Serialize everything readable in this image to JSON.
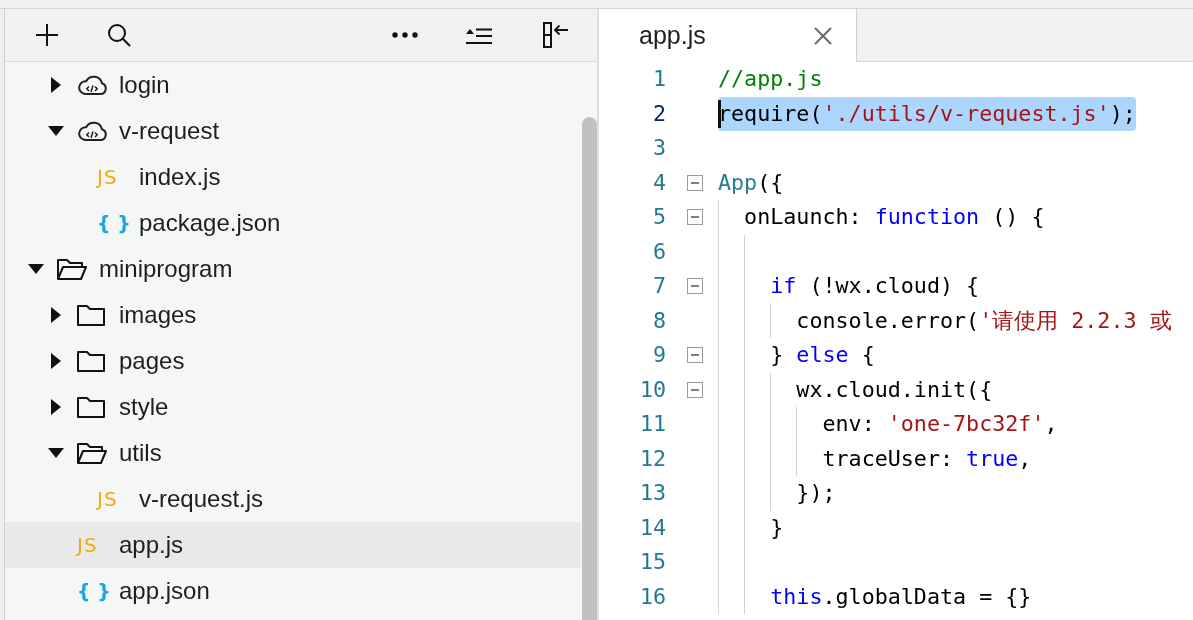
{
  "sidebar": {
    "tree": [
      {
        "children": [
          {
            "label": "login",
            "kind": "cloud_folder",
            "expanded": false,
            "selected": false
          },
          {
            "label": "v-request",
            "kind": "cloud_folder",
            "expanded": true,
            "selected": false,
            "children": [
              {
                "label": "index.js",
                "kind": "js",
                "icon_text": "JS",
                "selected": false
              },
              {
                "label": "package.json",
                "kind": "json",
                "icon_text": "{ }",
                "selected": false
              }
            ]
          }
        ]
      },
      {
        "label": "miniprogram",
        "kind": "folder",
        "expanded": true,
        "selected": false,
        "children": [
          {
            "label": "images",
            "kind": "folder",
            "expanded": false,
            "selected": false
          },
          {
            "label": "pages",
            "kind": "folder",
            "expanded": false,
            "selected": false
          },
          {
            "label": "style",
            "kind": "folder",
            "expanded": false,
            "selected": false
          },
          {
            "label": "utils",
            "kind": "folder",
            "expanded": true,
            "selected": false,
            "children": [
              {
                "label": "v-request.js",
                "kind": "js",
                "icon_text": "JS",
                "selected": false
              }
            ]
          },
          {
            "label": "app.js",
            "kind": "js",
            "icon_text": "JS",
            "selected": true
          },
          {
            "label": "app.json",
            "kind": "json",
            "icon_text": "{ }",
            "selected": false
          }
        ]
      }
    ]
  },
  "editor": {
    "tabs": [
      {
        "label": "app.js",
        "selected": true
      }
    ],
    "lines": [
      {
        "number": "1",
        "selected": false,
        "tokens": [
          {
            "kind": "comment",
            "text": "//app.js"
          }
        ]
      },
      {
        "number": "2",
        "selected": true,
        "tokens": [
          {
            "kind": "plain",
            "text": "require("
          },
          {
            "kind": "string",
            "text": "'./utils/v-request.js'"
          },
          {
            "kind": "plain",
            "text": ");"
          }
        ]
      },
      {
        "number": "3",
        "selected": false
      },
      {
        "number": "4",
        "selected": false,
        "folded": false,
        "tokens": [
          {
            "kind": "type",
            "text": "App"
          },
          {
            "kind": "plain",
            "text": "({"
          }
        ]
      },
      {
        "number": "5",
        "selected": false,
        "folded": false,
        "tokens": [
          {
            "kind": "plain",
            "text": "  onLaunch: "
          },
          {
            "kind": "keyword",
            "text": "function"
          },
          {
            "kind": "plain",
            "text": " () {"
          }
        ]
      },
      {
        "number": "6",
        "selected": false
      },
      {
        "number": "7",
        "selected": false,
        "folded": false,
        "tokens": [
          {
            "kind": "keyword",
            "text": "    if"
          },
          {
            "kind": "plain",
            "text": " (!wx.cloud) {"
          }
        ]
      },
      {
        "number": "8",
        "selected": false,
        "tokens": [
          {
            "kind": "plain",
            "text": "      console.error("
          },
          {
            "kind": "string",
            "text": "'请使用 2.2.3 或"
          }
        ]
      },
      {
        "number": "9",
        "selected": false,
        "folded": false,
        "tokens": [
          {
            "kind": "plain",
            "text": "    } "
          },
          {
            "kind": "keyword",
            "text": "else"
          },
          {
            "kind": "plain",
            "text": " {"
          }
        ]
      },
      {
        "number": "10",
        "selected": false,
        "folded": false,
        "tokens": [
          {
            "kind": "plain",
            "text": "      wx.cloud.init({"
          }
        ]
      },
      {
        "number": "11",
        "selected": false,
        "tokens": [
          {
            "kind": "plain",
            "text": "        env: "
          },
          {
            "kind": "string",
            "text": "'one-7bc32f'"
          },
          {
            "kind": "plain",
            "text": ","
          }
        ]
      },
      {
        "number": "12",
        "selected": false,
        "tokens": [
          {
            "kind": "plain",
            "text": "        traceUser: "
          },
          {
            "kind": "keyword",
            "text": "true"
          },
          {
            "kind": "plain",
            "text": ","
          }
        ]
      },
      {
        "number": "13",
        "selected": false,
        "tokens": [
          {
            "kind": "plain",
            "text": "      });"
          }
        ]
      },
      {
        "number": "14",
        "selected": false,
        "tokens": [
          {
            "kind": "plain",
            "text": "    }"
          }
        ]
      },
      {
        "number": "15",
        "selected": false
      },
      {
        "number": "16",
        "selected": false,
        "tokens": [
          {
            "kind": "keyword",
            "text": "    this"
          },
          {
            "kind": "plain",
            "text": ".globalData = {}"
          }
        ]
      }
    ]
  }
}
